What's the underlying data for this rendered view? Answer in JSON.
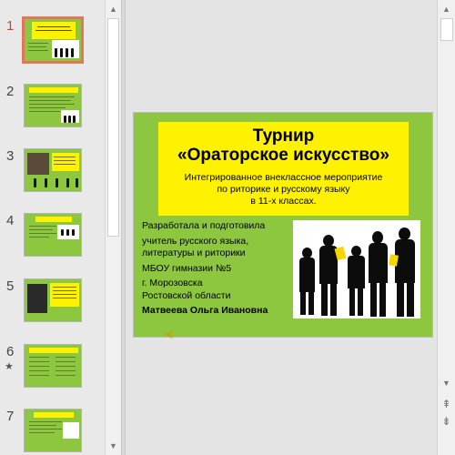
{
  "thumbnails": [
    {
      "number": "1",
      "star": ""
    },
    {
      "number": "2",
      "star": ""
    },
    {
      "number": "3",
      "star": ""
    },
    {
      "number": "4",
      "star": ""
    },
    {
      "number": "5",
      "star": ""
    },
    {
      "number": "6",
      "star": "★"
    },
    {
      "number": "7",
      "star": ""
    }
  ],
  "slide": {
    "title_line1": "Турнир",
    "title_line2": "«Ораторское искусство»",
    "subtitle_line1": "Интегрированное внеклассное мероприятие",
    "subtitle_line2": "по риторике и русскому языку",
    "subtitle_line3": "в 11-х классах.",
    "author_lines": [
      "Разработала и подготовила",
      "учитель русского языка,",
      "литературы и риторики",
      " МБОУ гимназии №5",
      "г. Морозовска",
      " Ростовской области",
      " Матвеева Ольга Ивановна"
    ]
  },
  "icons": {
    "up": "▲",
    "down": "▼",
    "prev_slide": "⇞",
    "next_slide": "⇟",
    "speaker": "◀)"
  },
  "colors": {
    "slide_green": "#8dc63f",
    "title_yellow": "#fff200",
    "active_number": "#c8472b",
    "active_border": "#e2765a"
  }
}
